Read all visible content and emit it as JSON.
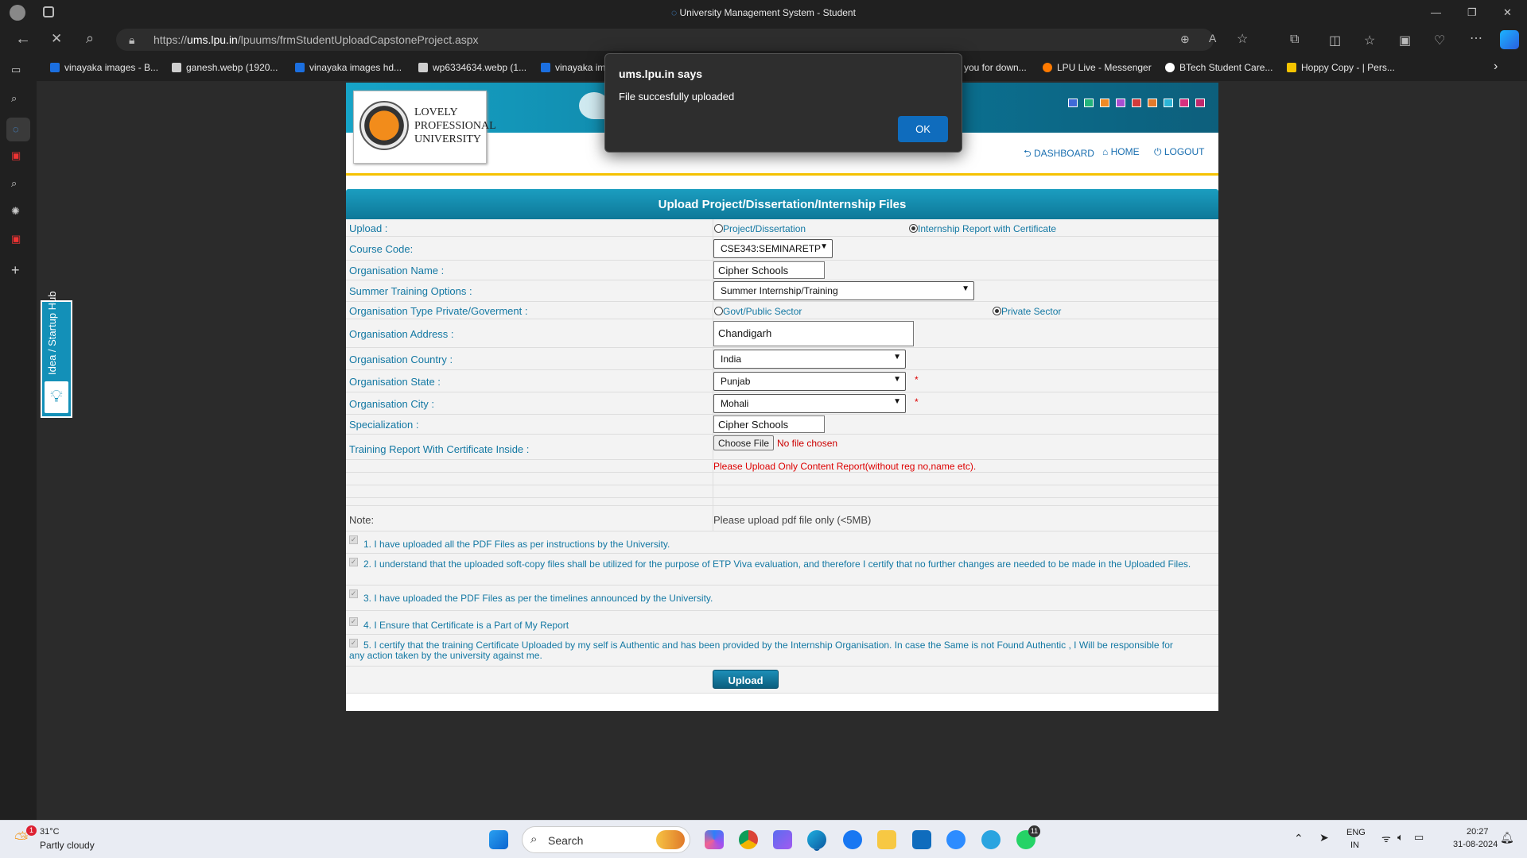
{
  "browser": {
    "window_title": "University Management System - Student",
    "url_prefix": "https://",
    "url_domain": "ums.lpu.in",
    "url_path": "/lpuums/frmStudentUploadCapstoneProject.aspx",
    "favorites": [
      {
        "label": "vinayaka images - B...",
        "color": "#1b6fe0"
      },
      {
        "label": "ganesh.webp (1920...",
        "color": "#cfcfcf"
      },
      {
        "label": "vinayaka images hd...",
        "color": "#1b6fe0"
      },
      {
        "label": "wp6334634.webp (1...",
        "color": "#cfcfcf"
      },
      {
        "label": "vinayaka im",
        "color": "#1b6fe0"
      },
      {
        "label": "you for down...",
        "color": "#e25a1c"
      },
      {
        "label": "LPU Live - Messenger",
        "color": "#ff7a00"
      },
      {
        "label": "BTech Student Care...",
        "color": "#ffffff"
      },
      {
        "label": "Hoppy Copy - | Pers...",
        "color": "#f5c400"
      }
    ]
  },
  "header": {
    "logo_lines": [
      "LOVELY",
      "PROFESSIONAL",
      "UNIVERSITY"
    ],
    "nav": {
      "dashboard": "DASHBOARD",
      "home": "HOME",
      "logout": "LOGOUT"
    },
    "theme_swatches": [
      "#3f6ad8",
      "#22b27a",
      "#f08a24",
      "#a64fd1",
      "#d33b3b",
      "#e07a2b",
      "#2bb3d6",
      "#d9307f",
      "#c0286c"
    ]
  },
  "form": {
    "title": "Upload Project/Dissertation/Internship Files",
    "upload_label": "Upload :",
    "upload_opt1": "Project/Dissertation",
    "upload_opt2": "Internship Report with Certificate",
    "course_label": "Course Code:",
    "course_value": "CSE343:SEMINARETP",
    "org_name_label": "Organisation Name :",
    "org_name_value": "Cipher Schools",
    "training_label": "Summer Training Options :",
    "training_value": "Summer Internship/Training",
    "org_type_label": "Organisation Type Private/Goverment :",
    "org_type_opt1": "Govt/Public Sector",
    "org_type_opt2": "Private Sector",
    "address_label": "Organisation Address :",
    "address_value": "Chandigarh",
    "country_label": "Organisation Country :",
    "country_value": "India",
    "state_label": "Organisation State :",
    "state_value": "Punjab",
    "city_label": "Organisation City :",
    "city_value": "Mohali",
    "required_mark": "*",
    "spec_label": "Specialization :",
    "spec_value": "Cipher Schools",
    "report_label": "Training Report With Certificate Inside :",
    "choose_file": "Choose File",
    "no_file": "No file chosen",
    "warning": "Please Upload Only Content Report(without reg no,name etc).",
    "note_label": "Note:",
    "note_value": "Please upload pdf file only (<5MB)",
    "declarations": [
      "1. I have uploaded all the PDF Files as per instructions by the University.",
      "2. I understand that the uploaded soft-copy files shall be utilized for the purpose of ETP Viva evaluation, and therefore I certify that no further changes are needed to be made in the Uploaded Files.",
      "3. I have uploaded the PDF Files as per the timelines announced by the University.",
      "4. I Ensure that Certificate is a Part of My Report",
      "5. I certify that the training Certificate Uploaded by my self is Authentic and has been provided by the Internship Organisation. In case the Same is not Found Authentic , I Will be responsible for any action taken by the university against me."
    ],
    "upload_button": "Upload"
  },
  "hub_label": "Idea / Startup Hub",
  "dialog": {
    "title": "ums.lpu.in says",
    "message": "File succesfully uploaded",
    "ok": "OK"
  },
  "taskbar": {
    "temperature": "31°C",
    "weather": "Partly cloudy",
    "search_placeholder": "Search",
    "lang1": "ENG",
    "lang2": "IN",
    "time": "20:27",
    "date": "31-08-2024",
    "whatsapp_badge": "11",
    "weather_badge": "1"
  }
}
